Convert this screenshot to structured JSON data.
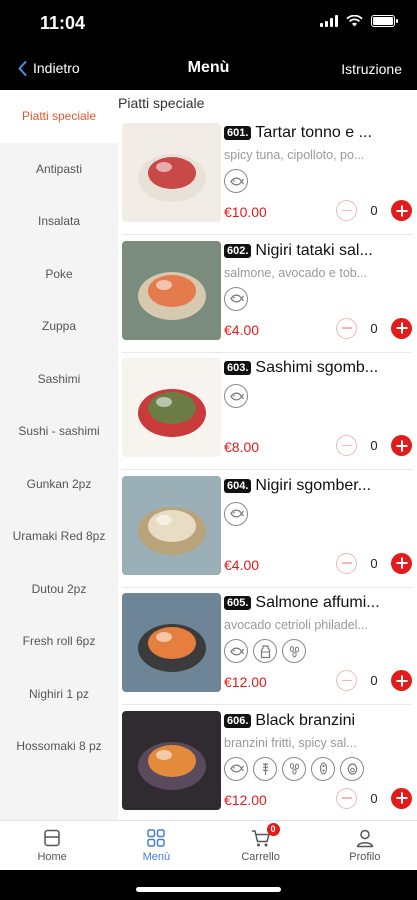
{
  "status": {
    "time": "11:04"
  },
  "nav": {
    "back_label": "Indietro",
    "title": "Menù",
    "action_label": "Istruzione"
  },
  "categories": [
    {
      "label": "Piatti speciale"
    },
    {
      "label": "Antipasti"
    },
    {
      "label": "Insalata"
    },
    {
      "label": "Poke"
    },
    {
      "label": "Zuppa"
    },
    {
      "label": "Sashimi"
    },
    {
      "label": "Sushi - sashimi"
    },
    {
      "label": "Gunkan 2pz"
    },
    {
      "label": "Uramaki Red 8pz"
    },
    {
      "label": "Dutou 2pz"
    },
    {
      "label": "Fresh roll 6pz"
    },
    {
      "label": "Nighiri 1 pz"
    },
    {
      "label": "Hossomaki 8 pz"
    }
  ],
  "active_category": "Piatti speciale",
  "section": {
    "title": "Piatti speciale"
  },
  "dishes": [
    {
      "code": "601.",
      "name": "Tartar tonno e ...",
      "desc": "spicy tuna, cipolloto, po...",
      "allergens": [
        "fish-icon"
      ],
      "price": "€10.00",
      "qty": "0"
    },
    {
      "code": "602.",
      "name": "Nigiri tataki sal...",
      "desc": "salmone, avocado e tob...",
      "allergens": [
        "fish-icon"
      ],
      "price": "€4.00",
      "qty": "0"
    },
    {
      "code": "603.",
      "name": "Sashimi sgomb...",
      "desc": "",
      "allergens": [
        "fish-icon"
      ],
      "price": "€8.00",
      "qty": "0"
    },
    {
      "code": "604.",
      "name": "Nigiri sgomber...",
      "desc": "",
      "allergens": [
        "fish-icon"
      ],
      "price": "€4.00",
      "qty": "0"
    },
    {
      "code": "605.",
      "name": "Salmone affumi...",
      "desc": "avocado cetrioli philadel...",
      "allergens": [
        "fish-icon",
        "milk-icon",
        "sesame-icon"
      ],
      "price": "€12.00",
      "qty": "0"
    },
    {
      "code": "606.",
      "name": "Black branzini",
      "desc": "branzini fritti, spicy sal...",
      "allergens": [
        "fish-icon",
        "gluten-icon",
        "sesame-icon",
        "soy-icon",
        "egg-icon"
      ],
      "price": "€12.00",
      "qty": "0"
    }
  ],
  "tabbar": {
    "home": "Home",
    "menu": "Menù",
    "cart": "Carrello",
    "cart_badge": "0",
    "profile": "Profilo"
  },
  "colors": {
    "accent": "#e21b1b",
    "active_category": "#e4572e",
    "active_tab": "#4a7cd6"
  }
}
